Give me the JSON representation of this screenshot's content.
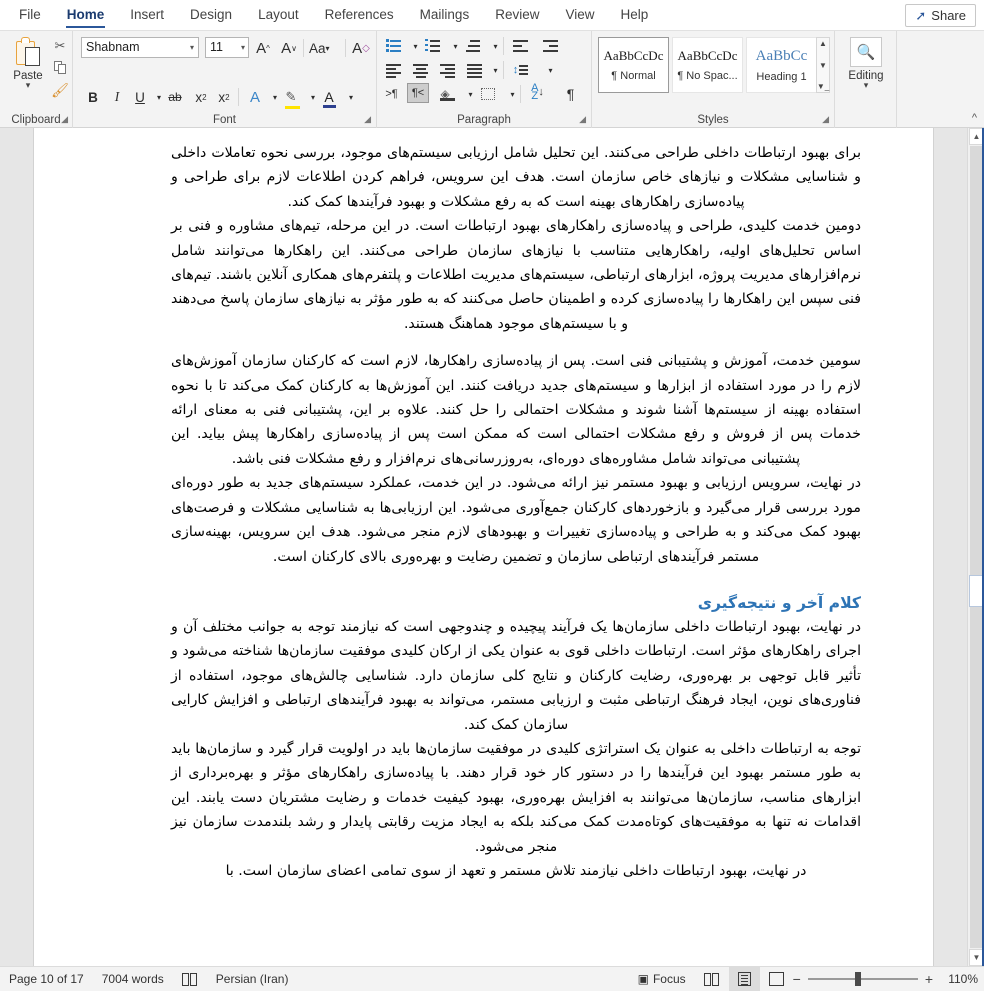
{
  "ribbon": {
    "tabs": [
      {
        "label": "File",
        "active": false
      },
      {
        "label": "Home",
        "active": true
      },
      {
        "label": "Insert",
        "active": false
      },
      {
        "label": "Design",
        "active": false
      },
      {
        "label": "Layout",
        "active": false
      },
      {
        "label": "References",
        "active": false
      },
      {
        "label": "Mailings",
        "active": false
      },
      {
        "label": "Review",
        "active": false
      },
      {
        "label": "View",
        "active": false
      },
      {
        "label": "Help",
        "active": false
      }
    ],
    "share_label": "Share",
    "groups": {
      "clipboard": {
        "label": "Clipboard",
        "paste_label": "Paste",
        "cut_icon": "scissors-icon",
        "copy_icon": "copy-icon",
        "format_painter_icon": "format-painter-icon"
      },
      "font": {
        "label": "Font",
        "font_name": "Shabnam",
        "font_size": "11",
        "grow_font": "A",
        "shrink_font": "A",
        "change_case": "Aa",
        "clear_formatting": "A",
        "bold": "B",
        "italic": "I",
        "underline": "U",
        "strikethrough": "ab",
        "subscript": "x",
        "superscript": "x",
        "text_effects": "A",
        "highlight": "A",
        "font_color": "A"
      },
      "paragraph": {
        "label": "Paragraph",
        "bullets": "bullets-icon",
        "numbering": "numbering-icon",
        "multilevel": "multilevel-list-icon",
        "decrease_indent": "decrease-indent-icon",
        "increase_indent": "increase-indent-icon",
        "align_left": "align-left-icon",
        "align_center": "align-center-icon",
        "align_right": "align-right-icon",
        "justify": "justify-icon",
        "line_spacing": "line-spacing-icon",
        "ltr_text": "ltr-direction-icon",
        "rtl_text": "rtl-direction-icon",
        "shading": "shading-icon",
        "borders": "borders-icon",
        "sort": "sort-az-icon",
        "show_marks": "pilcrow-icon",
        "rtl_selected": true
      },
      "styles": {
        "label": "Styles",
        "items": [
          {
            "preview": "AaBbCcDc",
            "name": "¶ Normal",
            "active": true
          },
          {
            "preview": "AaBbCcDc",
            "name": "¶ No Spac...",
            "active": false
          },
          {
            "preview": "AaBbCс",
            "name": "Heading 1",
            "active": false
          }
        ]
      },
      "editing": {
        "label": "Editing",
        "search_icon": "magnifier-icon"
      }
    }
  },
  "document": {
    "blocks": [
      {
        "type": "paragraph",
        "text": "برای بهبود ارتباطات داخلی طراحی می‌کنند. این تحلیل شامل ارزیابی سیستم‌های موجود، بررسی نحوه تعاملات داخلی و شناسایی مشکلات و نیازهای خاص سازمان است. هدف این سرویس، فراهم کردن اطلاعات لازم برای طراحی و پیاده‌سازی راهکارهای بهینه است که به رفع مشکلات و بهبود فرآیندها کمک کند."
      },
      {
        "type": "paragraph",
        "text": "دومین خدمت کلیدی، طراحی و پیاده‌سازی راهکارهای بهبود ارتباطات است. در این مرحله، تیم‌های مشاوره و فنی بر اساس تحلیل‌های اولیه، راهکارهایی متناسب با نیازهای سازمان طراحی می‌کنند. این راهکارها می‌توانند شامل نرم‌افزارهای مدیریت پروژه، ابزارهای ارتباطی، سیستم‌های مدیریت اطلاعات و پلتفرم‌های همکاری آنلاین باشند. تیم‌های فنی سپس این راهکارها را پیاده‌سازی کرده و اطمینان حاصل می‌کنند که به طور مؤثر به نیازهای سازمان پاسخ می‌دهند و با سیستم‌های موجود هماهنگ هستند."
      },
      {
        "type": "paragraph",
        "text": "سومین خدمت، آموزش و پشتیبانی فنی است. پس از پیاده‌سازی راهکارها، لازم است که کارکنان سازمان آموزش‌های لازم را در مورد استفاده از ابزارها و سیستم‌های جدید دریافت کنند. این آموزش‌ها به کارکنان کمک می‌کند تا با نحوه استفاده بهینه از سیستم‌ها آشنا شوند و مشکلات احتمالی را حل کنند. علاوه بر این، پشتیبانی فنی به معنای ارائه خدمات پس از فروش و رفع مشکلات احتمالی است که ممکن است پس از پیاده‌سازی راهکارها پیش بیاید. این پشتیبانی می‌تواند شامل مشاوره‌های دوره‌ای، به‌روزرسانی‌های نرم‌افزار و رفع مشکلات فنی باشد."
      },
      {
        "type": "paragraph",
        "text": "در نهایت، سرویس ارزیابی و بهبود مستمر نیز ارائه می‌شود. در این خدمت، عملکرد سیستم‌های جدید به طور دوره‌ای مورد بررسی قرار می‌گیرد و بازخوردهای کارکنان جمع‌آوری می‌شود. این ارزیابی‌ها به شناسایی مشکلات و فرصت‌های بهبود کمک می‌کند و به طراحی و پیاده‌سازی تغییرات و بهبودهای لازم منجر می‌شود. هدف این سرویس، بهینه‌سازی مستمر فرآیندهای ارتباطی سازمان و تضمین رضایت و بهره‌وری بالای کارکنان است."
      },
      {
        "type": "heading",
        "text": "کلام آخر و نتیجه‌گیری"
      },
      {
        "type": "paragraph",
        "text": "در نهایت، بهبود ارتباطات داخلی سازمان‌ها یک فرآیند پیچیده و چندوجهی است که نیازمند توجه به جوانب مختلف آن و اجرای راهکارهای مؤثر است. ارتباطات داخلی قوی به عنوان یکی از ارکان کلیدی موفقیت سازمان‌ها شناخته می‌شود و تأثیر قابل توجهی بر بهره‌وری، رضایت کارکنان و نتایج کلی سازمان دارد. شناسایی چالش‌های موجود، استفاده از فناوری‌های نوین، ایجاد فرهنگ ارتباطی مثبت و ارزیابی مستمر، می‌تواند به بهبود فرآیندهای ارتباطی و افزایش کارایی سازمان کمک کند."
      },
      {
        "type": "paragraph",
        "text": "توجه به ارتباطات داخلی به عنوان یک استراتژی کلیدی در موفقیت سازمان‌ها باید در اولویت قرار گیرد و سازمان‌ها باید به طور مستمر بهبود این فرآیندها را در دستور کار خود قرار دهند. با پیاده‌سازی راهکارهای مؤثر و بهره‌برداری از ابزارهای مناسب، سازمان‌ها می‌توانند به افزایش بهره‌وری، بهبود کیفیت خدمات و رضایت مشتریان دست یابند. این اقدامات نه تنها به موفقیت‌های کوتاه‌مدت کمک می‌کند بلکه به ایجاد مزیت رقابتی پایدار و رشد بلندمدت سازمان نیز منجر می‌شود."
      },
      {
        "type": "paragraph",
        "text": "در نهایت، بهبود ارتباطات داخلی نیازمند تلاش مستمر و تعهد از سوی تمامی اعضای سازمان است. با"
      }
    ]
  },
  "statusbar": {
    "page": "Page 10 of 17",
    "words": "7004 words",
    "proofing_icon": "proofing-icon",
    "language": "Persian (Iran)",
    "focus": "Focus",
    "read_mode_icon": "read-mode-icon",
    "print_layout_icon": "print-layout-icon",
    "web_layout_icon": "web-layout-icon",
    "zoom_out": "−",
    "zoom_in": "+",
    "zoom_level": "110%"
  }
}
